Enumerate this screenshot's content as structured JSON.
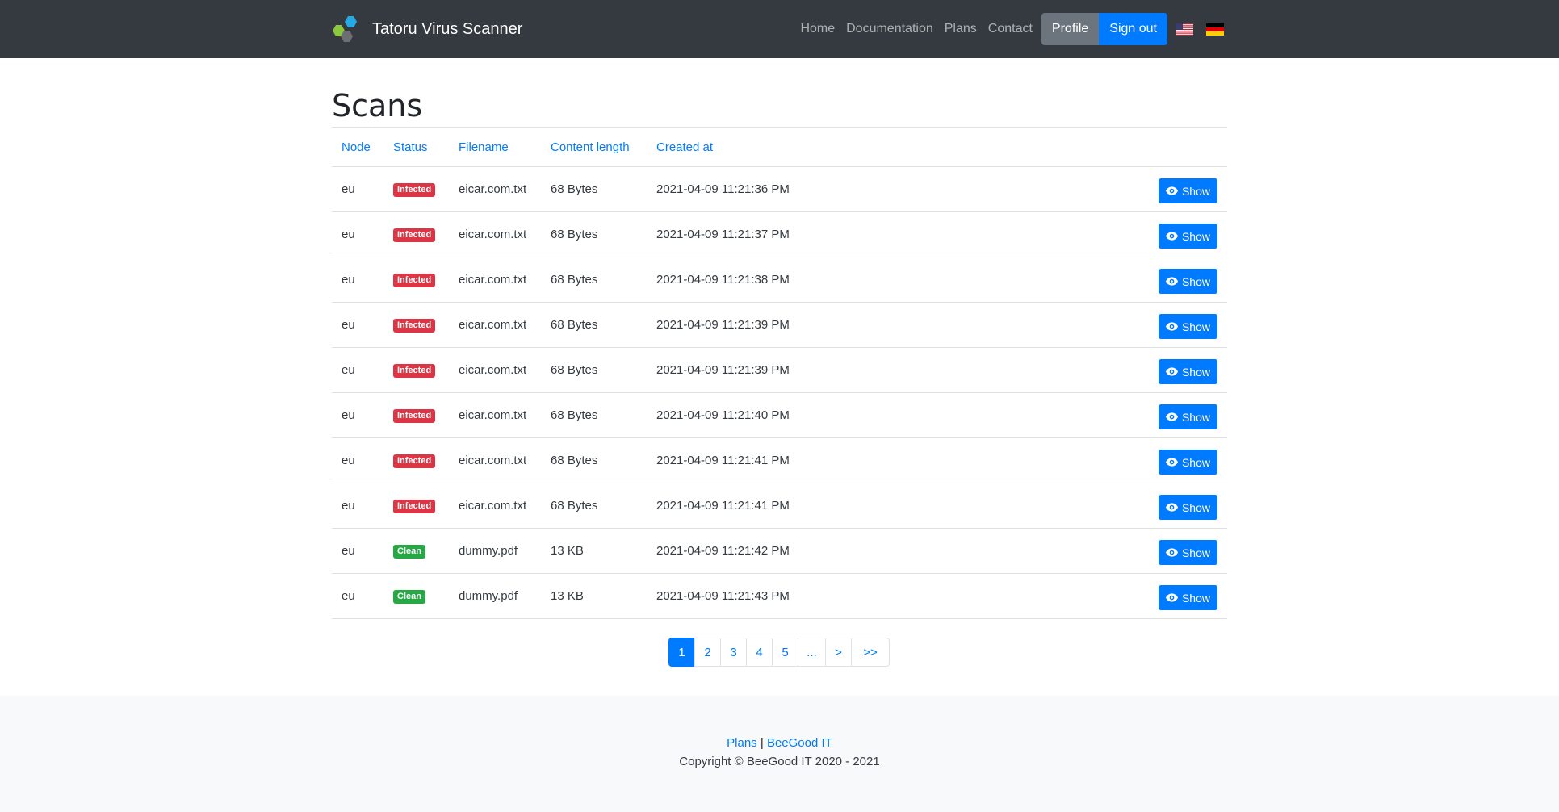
{
  "brand": {
    "name": "Tatoru Virus Scanner"
  },
  "nav": {
    "home": "Home",
    "documentation": "Documentation",
    "plans": "Plans",
    "contact": "Contact",
    "profile": "Profile",
    "signout": "Sign out",
    "flags": [
      "us-flag-icon",
      "de-flag-icon"
    ]
  },
  "page": {
    "title": "Scans"
  },
  "table": {
    "headers": [
      "Node",
      "Status",
      "Filename",
      "Content length",
      "Created at"
    ],
    "show_label": "Show",
    "rows": [
      {
        "node": "eu",
        "status": "Infected",
        "filename": "eicar.com.txt",
        "length": "68 Bytes",
        "created": "2021-04-09 11:21:36 PM"
      },
      {
        "node": "eu",
        "status": "Infected",
        "filename": "eicar.com.txt",
        "length": "68 Bytes",
        "created": "2021-04-09 11:21:37 PM"
      },
      {
        "node": "eu",
        "status": "Infected",
        "filename": "eicar.com.txt",
        "length": "68 Bytes",
        "created": "2021-04-09 11:21:38 PM"
      },
      {
        "node": "eu",
        "status": "Infected",
        "filename": "eicar.com.txt",
        "length": "68 Bytes",
        "created": "2021-04-09 11:21:39 PM"
      },
      {
        "node": "eu",
        "status": "Infected",
        "filename": "eicar.com.txt",
        "length": "68 Bytes",
        "created": "2021-04-09 11:21:39 PM"
      },
      {
        "node": "eu",
        "status": "Infected",
        "filename": "eicar.com.txt",
        "length": "68 Bytes",
        "created": "2021-04-09 11:21:40 PM"
      },
      {
        "node": "eu",
        "status": "Infected",
        "filename": "eicar.com.txt",
        "length": "68 Bytes",
        "created": "2021-04-09 11:21:41 PM"
      },
      {
        "node": "eu",
        "status": "Infected",
        "filename": "eicar.com.txt",
        "length": "68 Bytes",
        "created": "2021-04-09 11:21:41 PM"
      },
      {
        "node": "eu",
        "status": "Clean",
        "filename": "dummy.pdf",
        "length": "13 KB",
        "created": "2021-04-09 11:21:42 PM"
      },
      {
        "node": "eu",
        "status": "Clean",
        "filename": "dummy.pdf",
        "length": "13 KB",
        "created": "2021-04-09 11:21:43 PM"
      }
    ]
  },
  "pagination": {
    "items": [
      "1",
      "2",
      "3",
      "4",
      "5",
      "...",
      ">",
      ">>"
    ],
    "active": "1"
  },
  "footer": {
    "link_plans": "Plans",
    "separator": "|",
    "link_company": "BeeGood IT",
    "copyright": "Copyright © BeeGood IT 2020 - 2021"
  },
  "colors": {
    "navbar": "#343a40",
    "primary": "#007bff",
    "danger": "#dc3545",
    "success": "#28a745",
    "secondary": "#6c757d"
  }
}
